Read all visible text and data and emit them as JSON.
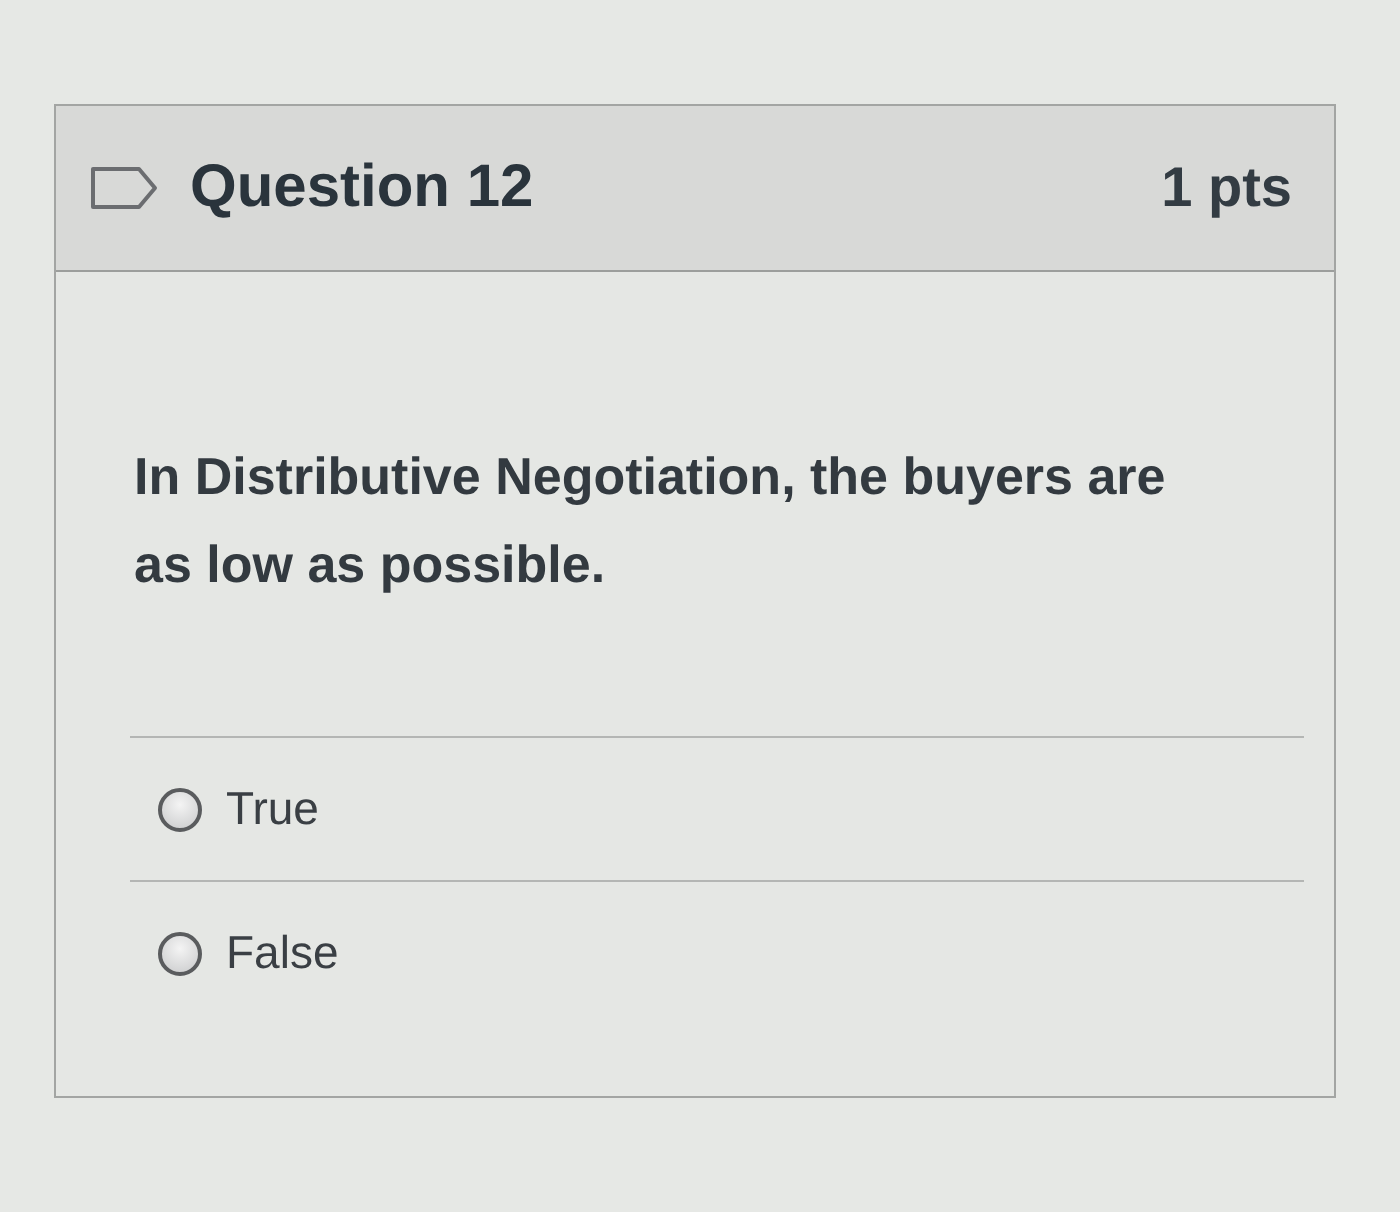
{
  "question": {
    "flagged": false,
    "title": "Question 12",
    "points": "1 pts",
    "text": "In Distributive Negotiation, the buyers are as low as possible.",
    "answers": [
      {
        "label": "True",
        "selected": false
      },
      {
        "label": "False",
        "selected": false
      }
    ]
  }
}
